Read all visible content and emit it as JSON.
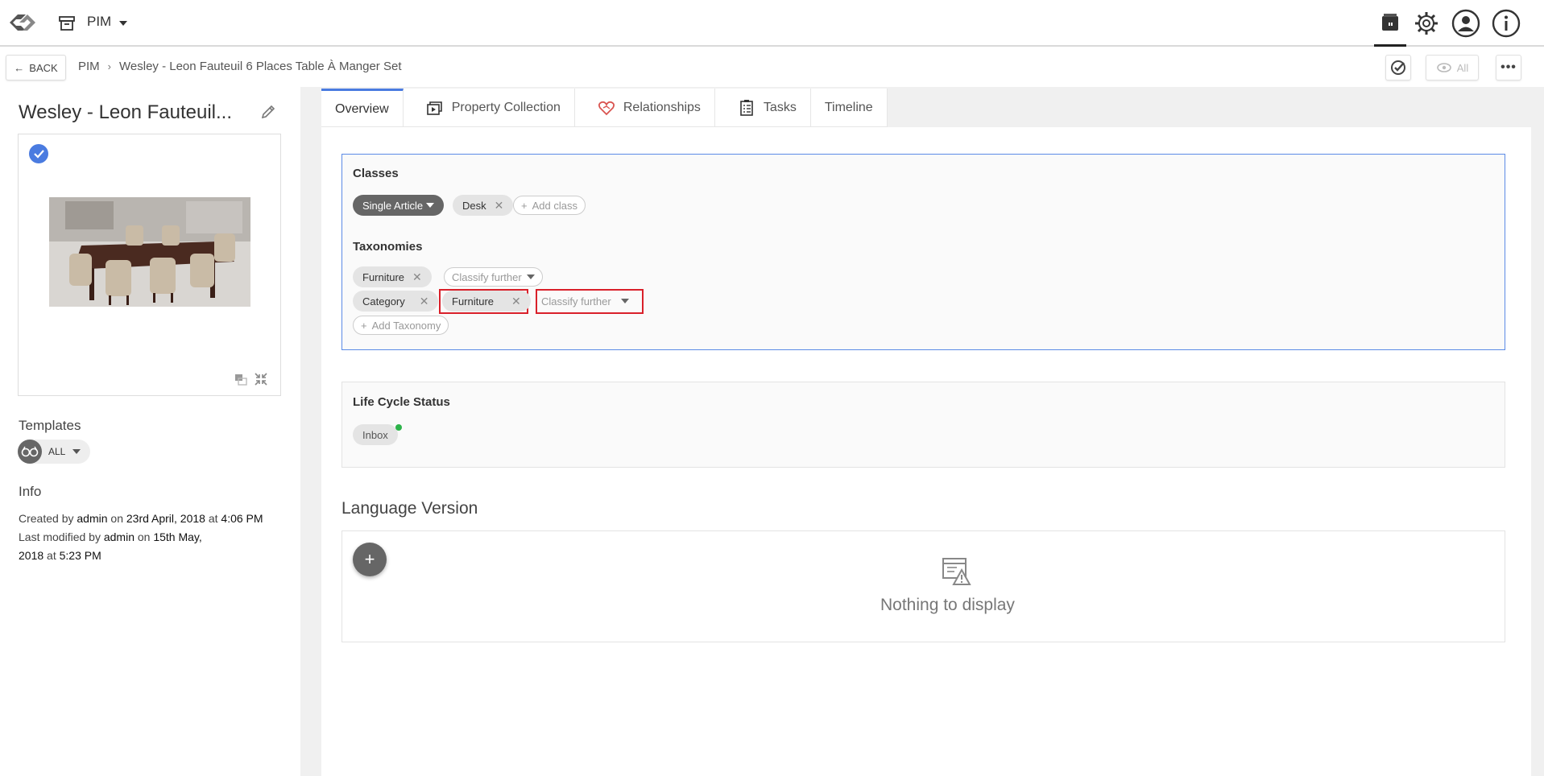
{
  "app": {
    "module": "PIM"
  },
  "header": {
    "back_label": "BACK",
    "breadcrumb": [
      "PIM",
      "Wesley - Leon Fauteuil 6 Places Table À Manger Set"
    ],
    "view_label": "All"
  },
  "entity": {
    "title": "Wesley - Leon Fauteuil...",
    "templates_label": "Templates",
    "templates_value": "ALL",
    "info_label": "Info",
    "info": {
      "created_prefix": "Created by",
      "created_by": "admin",
      "created_on_label": "on",
      "created_date": "23rd April, 2018",
      "at_label": "at",
      "created_time": "4:06 PM",
      "modified_prefix": "Last modified by",
      "modified_by": "admin",
      "modified_on_label": "on",
      "modified_date": "15th May,",
      "modified_date2": "2018",
      "modified_at_label": "at",
      "modified_time": "5:23 PM"
    }
  },
  "tabs": [
    "Overview",
    "Property Collection",
    "Relationships",
    "Tasks",
    "Timeline"
  ],
  "classes": {
    "title": "Classes",
    "primary": "Single Article",
    "secondary": "Desk",
    "add_label": "Add class"
  },
  "taxonomies": {
    "title": "Taxonomies",
    "row1": {
      "chip": "Furniture",
      "classify": "Classify further"
    },
    "row2": {
      "chip1": "Category",
      "chip2": "Furniture",
      "classify": "Classify further"
    },
    "add_label": "Add Taxonomy"
  },
  "lifecycle": {
    "title": "Life Cycle Status",
    "status": "Inbox"
  },
  "language": {
    "title": "Language Version",
    "empty": "Nothing to display",
    "add": "+"
  },
  "colors": {
    "accent": "#4a7be0",
    "highlight": "#d9202a",
    "status_dot": "#2db34a"
  }
}
